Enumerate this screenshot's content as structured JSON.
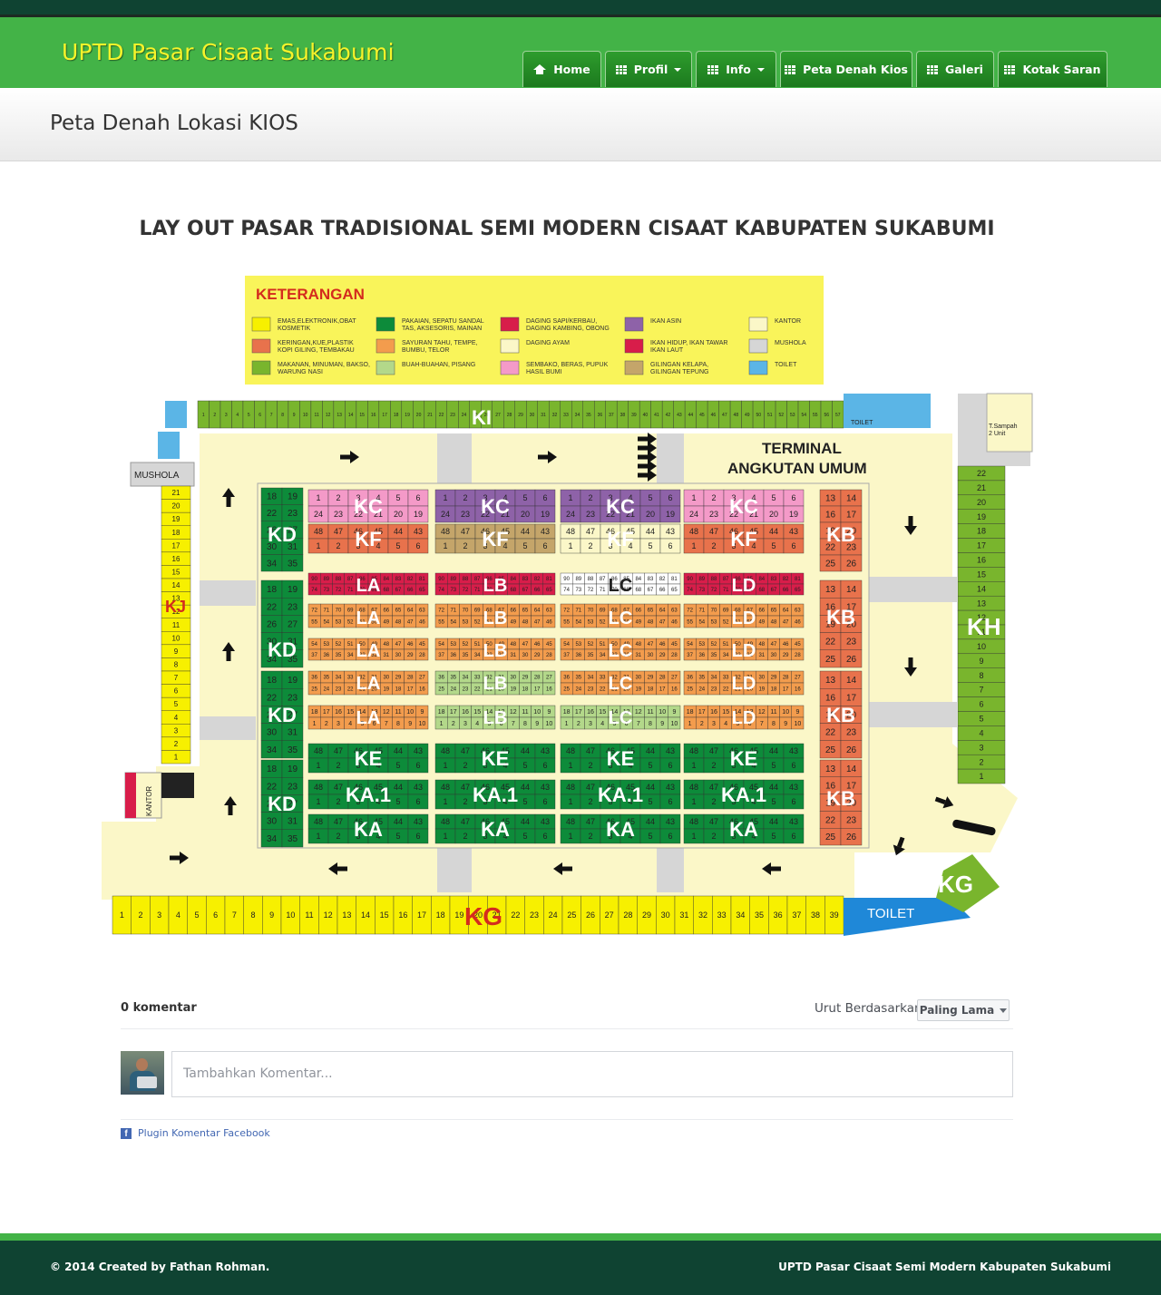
{
  "brand": "UPTD Pasar Cisaat Sukabumi",
  "nav": {
    "home": "Home",
    "profil": "Profil",
    "info": "Info",
    "peta": "Peta Denah Kios",
    "galeri": "Galeri",
    "kotak": "Kotak Saran"
  },
  "page_title": "Peta Denah Lokasi KIOS",
  "map": {
    "title": "LAY OUT PASAR TRADISIONAL SEMI MODERN CISAAT KABUPATEN SUKABUMI",
    "legend_title": "KETERANGAN",
    "legend": [
      {
        "color": "#f7f000",
        "text": [
          "EMAS,ELEKTRONIK,OBAT",
          "KOSMETIK"
        ]
      },
      {
        "color": "#e8724c",
        "text": [
          "KERINGAN,KUE,PLASTIK",
          "KOPI GILING, TEMBAKAU"
        ]
      },
      {
        "color": "#79b52d",
        "text": [
          "MAKANAN, MINUMAN, BAKSO,",
          "WARUNG NASI"
        ]
      },
      {
        "color": "#0d8b3a",
        "text": [
          "PAKAIAN, SEPATU SANDAL",
          "TAS, AKSESORIS, MAINAN"
        ]
      },
      {
        "color": "#f39c4d",
        "text": [
          "SAYURAN TAHU, TEMPE,",
          "BUMBU, TELOR"
        ]
      },
      {
        "color": "#b3d88a",
        "text": [
          "BUAH-BUAHAN, PISANG"
        ]
      },
      {
        "color": "#d81d4a",
        "text": [
          "DAGING SAPI/KERBAU,",
          "DAGING KAMBING, OBONG"
        ]
      },
      {
        "color": "#fbf7c8",
        "text": [
          "DAGING AYAM"
        ]
      },
      {
        "color": "#f49ac8",
        "text": [
          "SEMBAKO, BERAS, PUPUK",
          "HASIL BUMI"
        ]
      },
      {
        "color": "#8e62a8",
        "text": [
          "IKAN ASIN"
        ]
      },
      {
        "color": "#d81d4a",
        "text": [
          "IKAN HIDUP, IKAN TAWAR",
          "IKAN LAUT"
        ]
      },
      {
        "color": "#c4a56a",
        "text": [
          "GILINGAN KELAPA,",
          "GILINGAN TEPUNG"
        ]
      },
      {
        "color": "#fbf7c8",
        "text": [
          "KANTOR"
        ]
      },
      {
        "color": "#d6d6d6",
        "text": [
          "MUSHOLA"
        ]
      },
      {
        "color": "#5bb5e6",
        "text": [
          "TOILET"
        ]
      }
    ],
    "terminal": [
      "TERMINAL",
      "ANGKUTAN UMUM"
    ],
    "labels": {
      "ki": "KI",
      "kj": "KJ",
      "kh": "KH",
      "kg_bottom": "KG",
      "kg_corner": "KG",
      "toilet": "TOILET",
      "toilet_small": "TOILET",
      "mushola": "MUSHOLA",
      "kantor": "KANTOR",
      "sampah": [
        "T.Sampah",
        "2 Unit"
      ],
      "kc": "KC",
      "kf": "KF",
      "kd": "KD",
      "kb": "KB",
      "la": "LA",
      "lb": "LB",
      "lc": "LC",
      "ld": "LD",
      "ke": "KE",
      "ka1": "KA.1",
      "ka": "KA"
    }
  },
  "comments": {
    "count": "0 komentar",
    "sort_label": "Urut Berdasarkan",
    "sort_value": "Paling Lama",
    "placeholder": "Tambahkan Komentar...",
    "plugin": "Plugin Komentar Facebook"
  },
  "footer": {
    "left": "© 2014 Created by Fathan Rohman.",
    "right": "UPTD Pasar Cisaat Semi Modern Kabupaten Sukabumi"
  }
}
